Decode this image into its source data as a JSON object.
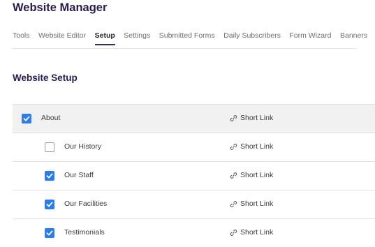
{
  "app": {
    "title": "Website Manager"
  },
  "tabs": [
    {
      "label": "Tools",
      "active": false
    },
    {
      "label": "Website Editor",
      "active": false
    },
    {
      "label": "Setup",
      "active": true
    },
    {
      "label": "Settings",
      "active": false
    },
    {
      "label": "Submitted Forms",
      "active": false
    },
    {
      "label": "Daily Subscribers",
      "active": false
    },
    {
      "label": "Form Wizard",
      "active": false
    },
    {
      "label": "Banners",
      "active": false
    }
  ],
  "section": {
    "title": "Website Setup"
  },
  "pages": [
    {
      "label": "About",
      "checked": true,
      "level": "parent",
      "link_label": "Short Link",
      "link_icon": "link-icon"
    },
    {
      "label": "Our History",
      "checked": false,
      "level": "child",
      "link_label": "Short Link",
      "link_icon": "link-icon"
    },
    {
      "label": "Our Staff",
      "checked": true,
      "level": "child",
      "link_label": "Short Link",
      "link_icon": "link-icon"
    },
    {
      "label": "Our Facilities",
      "checked": true,
      "level": "child",
      "link_label": "Short Link",
      "link_icon": "link-icon"
    },
    {
      "label": "Testimonials",
      "checked": true,
      "level": "child",
      "link_label": "Short Link",
      "link_icon": "link-icon"
    }
  ],
  "colors": {
    "title": "#2a1a52",
    "checkbox_checked": "#2b7de9",
    "row_highlight": "#f1f1f1",
    "active_tab_underline": "#3a2a6e"
  }
}
